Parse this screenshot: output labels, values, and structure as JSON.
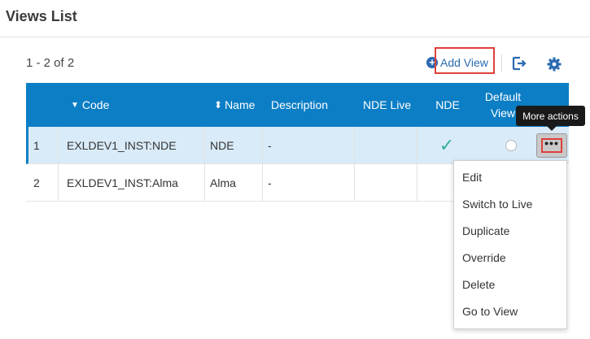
{
  "page": {
    "title": "Views List"
  },
  "pagination": {
    "range": "1 - 2 of 2"
  },
  "toolbar": {
    "add_label": "Add View",
    "add_icon": "plus-circle-icon",
    "export_icon": "export-icon",
    "settings_icon": "gear-icon"
  },
  "table": {
    "headers": {
      "code_sort": "▼",
      "code": "Code",
      "name_sort": "⬍",
      "name": "Name",
      "description": "Description",
      "nde_live": "NDE Live",
      "nde": "NDE",
      "default_view_line1": "Default",
      "default_view_line2": "View"
    },
    "rows": [
      {
        "index": "1",
        "code": "EXLDEV1_INST:NDE",
        "name": "NDE",
        "description": "-",
        "nde_live": "",
        "nde": "✓",
        "default_view": "radio"
      },
      {
        "index": "2",
        "code": "EXLDEV1_INST:Alma",
        "name": "Alma",
        "description": "-",
        "nde_live": "",
        "nde": "",
        "default_view": ""
      }
    ]
  },
  "actions": {
    "more_label": "•••",
    "tooltip": "More actions",
    "menu": [
      "Edit",
      "Switch to Live",
      "Duplicate",
      "Override",
      "Delete",
      "Go to View"
    ]
  },
  "colors": {
    "header_bg": "#0c7ec5",
    "selected_row_bg": "#d9ebf8",
    "link": "#2a6ab0",
    "check": "#35b094",
    "highlight": "#e0403b"
  }
}
